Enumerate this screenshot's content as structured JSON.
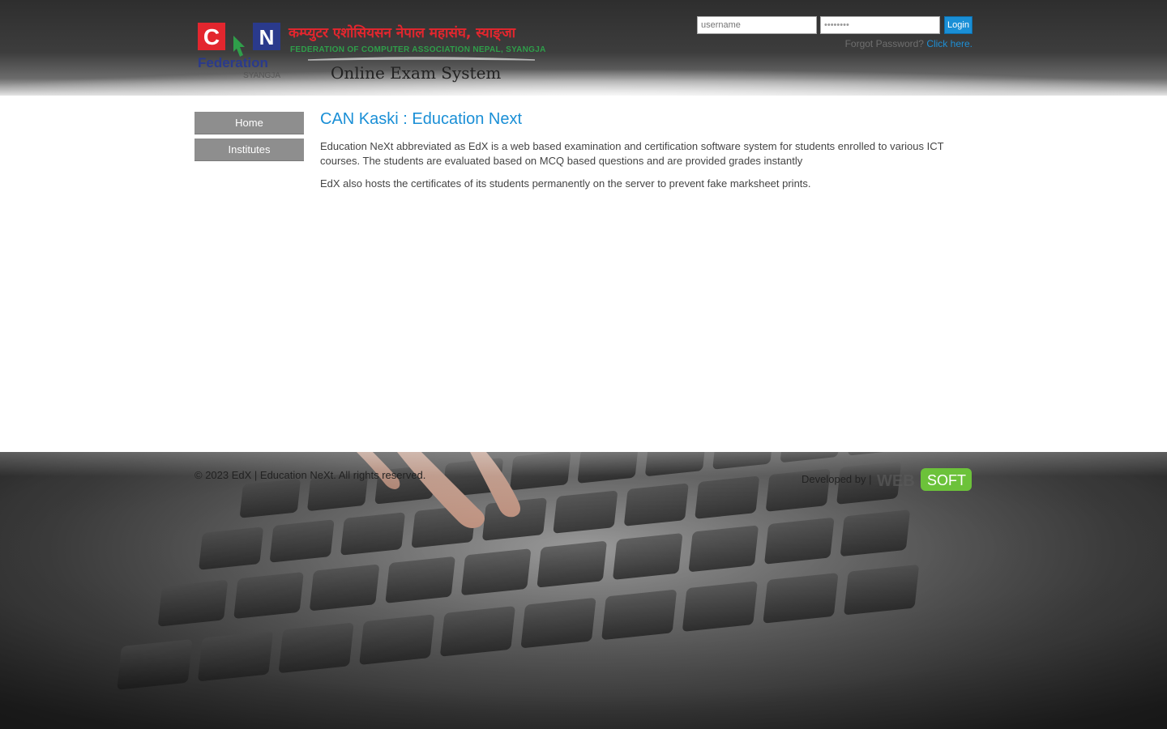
{
  "header": {
    "logo": {
      "letters": [
        "C",
        "N"
      ],
      "federation": "Federation",
      "district": "SYANGJA",
      "nepali_title": "कम्प्युटर एशोसियसन नेपाल महासंघ, स्याङ्जा",
      "english_title": "FEDERATION OF COMPUTER ASSOCIATION NEPAL, SYANGJA",
      "tagline": "Online Exam System"
    },
    "login": {
      "username_placeholder": "username",
      "password_value": "••••••••",
      "login_label": "Login",
      "forgot_text": "Forgot Password?",
      "forgot_link": "Click here."
    }
  },
  "sidebar": {
    "items": [
      {
        "label": "Home"
      },
      {
        "label": "Institutes"
      }
    ]
  },
  "content": {
    "title": "CAN Kaski : Education Next",
    "paragraphs": [
      "Education NeXt abbreviated as EdX is a web based examination and certification software system for students enrolled to various ICT courses. The students are evaluated based on MCQ based questions and are provided grades instantly",
      "EdX also hosts the certificates of its students permanently on the server to prevent fake marksheet prints."
    ]
  },
  "footer": {
    "copyright": "© 2023 EdX | Education NeXt. All rights reserved.",
    "developed_by": "Developed by |",
    "developer_logo": {
      "part1": "WEB",
      "part2": "SOFT"
    }
  },
  "colors": {
    "accent_blue": "#1a8fd6",
    "nav_gray": "#8e8e8e",
    "logo_red": "#e3262e",
    "logo_blue": "#2a3a8c",
    "logo_green": "#2f9e4a",
    "dev_green": "#6cc23a"
  }
}
